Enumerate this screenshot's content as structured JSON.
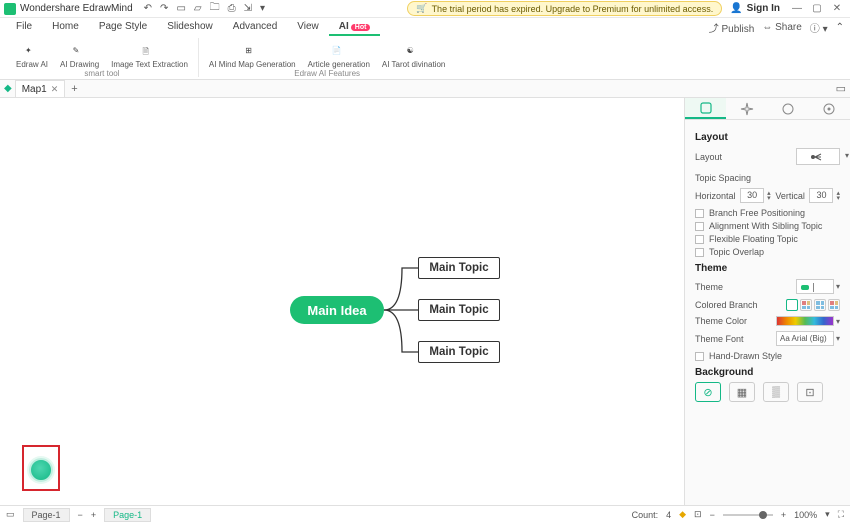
{
  "app_title": "Wondershare EdrawMind",
  "trial_text": "The trial period has expired. Upgrade to Premium for unlimited access.",
  "signin": "Sign In",
  "menubar": {
    "items": [
      "File",
      "Home",
      "Page Style",
      "Slideshow",
      "Advanced",
      "View",
      "AI"
    ],
    "ai_badge": "Hot",
    "right": {
      "publish": "Publish",
      "share": "Share"
    }
  },
  "ribbon": {
    "groups": [
      {
        "label": "smart tool",
        "items": [
          {
            "label": "Edraw\nAI"
          },
          {
            "label": "AI\nDrawing"
          },
          {
            "label": "Image Text\nExtraction"
          }
        ]
      },
      {
        "label": "Edraw AI Features",
        "items": [
          {
            "label": "AI Mind Map\nGeneration"
          },
          {
            "label": "Article\ngeneration"
          },
          {
            "label": "AI Tarot\ndivination"
          }
        ]
      }
    ]
  },
  "doc_tab": "Map1",
  "mindmap": {
    "root": "Main Idea",
    "topics": [
      "Main Topic",
      "Main Topic",
      "Main Topic"
    ]
  },
  "panel": {
    "layout_title": "Layout",
    "layout_label": "Layout",
    "topic_spacing": "Topic Spacing",
    "horizontal": "Horizontal",
    "vertical": "Vertical",
    "h_val": "30",
    "v_val": "30",
    "checks": [
      "Branch Free Positioning",
      "Alignment With Sibling Topic",
      "Flexible Floating Topic",
      "Topic Overlap"
    ],
    "theme_title": "Theme",
    "theme_label": "Theme",
    "colored_branch": "Colored Branch",
    "theme_color": "Theme Color",
    "theme_font": "Theme Font",
    "font_value": "Aa Arial (Big)",
    "hand_drawn": "Hand-Drawn Style",
    "background_title": "Background"
  },
  "status": {
    "page_tab": "Page-1",
    "active_page": "Page-1",
    "count_label": "Count:",
    "count_val": "4",
    "zoom": "100%"
  }
}
